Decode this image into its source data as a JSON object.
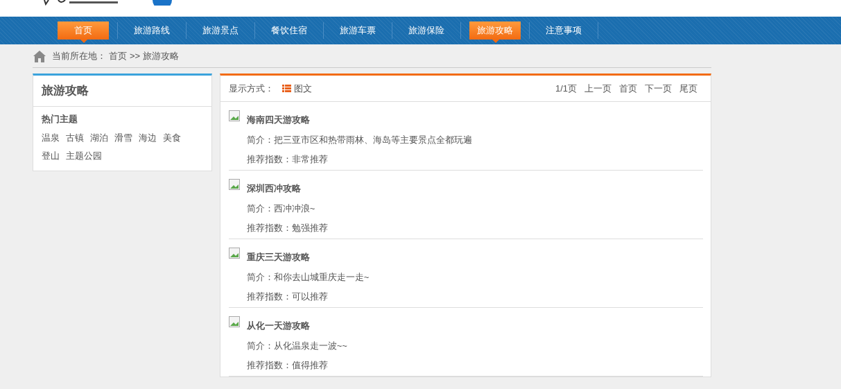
{
  "nav": [
    {
      "label": "首页",
      "selected": true
    },
    {
      "label": "旅游路线",
      "selected": false
    },
    {
      "label": "旅游景点",
      "selected": false
    },
    {
      "label": "餐饮住宿",
      "selected": false
    },
    {
      "label": "旅游车票",
      "selected": false
    },
    {
      "label": "旅游保险",
      "selected": false
    },
    {
      "label": "旅游攻略",
      "selected": true
    },
    {
      "label": "注意事项",
      "selected": false
    }
  ],
  "breadcrumb": {
    "prefix": "当前所在地：",
    "links": [
      "首页",
      "旅游攻略"
    ],
    "separator": ">>"
  },
  "sidebar": {
    "title": "旅游攻略",
    "section_title": "热门主题",
    "tags": [
      "温泉",
      "古镇",
      "湖泊",
      "滑雪",
      "海边",
      "美食",
      "登山",
      "主题公园"
    ]
  },
  "toolbar": {
    "display_label": "显示方式：",
    "display_mode": "图文",
    "page_info": "1/1页",
    "pager": [
      "上一页",
      "首页",
      "下一页",
      "尾页"
    ]
  },
  "articles": [
    {
      "title": "海南四天游攻略",
      "intro": "简介：把三亚市区和热带雨林、海岛等主要景点全都玩遍",
      "rating": "推荐指数：非常推荐"
    },
    {
      "title": "深圳西冲攻略",
      "intro": "简介：西冲冲浪~",
      "rating": "推荐指数：勉强推荐"
    },
    {
      "title": "重庆三天游攻略",
      "intro": "简介：和你去山城重庆走一走~",
      "rating": "推荐指数：可以推荐"
    },
    {
      "title": "从化一天游攻略",
      "intro": "简介：从化温泉走一波~~",
      "rating": "推荐指数：值得推荐"
    }
  ]
}
